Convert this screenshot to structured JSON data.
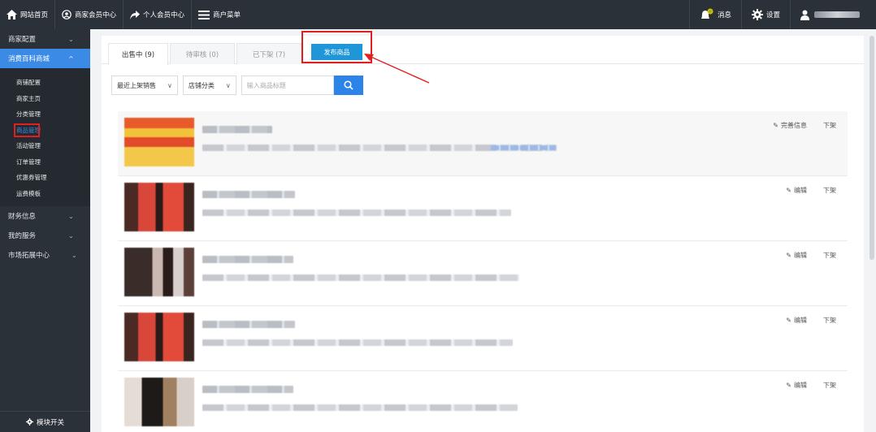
{
  "topbar": {
    "home": "网站首页",
    "merchant_center": "商家会员中心",
    "personal_center": "个人会员中心",
    "merchant_menu": "商户菜单",
    "messages": "消息",
    "settings": "设置"
  },
  "sidebar": {
    "merchant_config": "商家配置",
    "mall": "消费百科商城",
    "sub_items": [
      "商铺配置",
      "商家主页",
      "分类管理",
      "商品管理",
      "活动管理",
      "订单管理",
      "优惠券管理",
      "运费模板"
    ],
    "finance": "财务信息",
    "my_services": "我的服务",
    "market_center": "市场拓展中心",
    "module_switch": "模块开关"
  },
  "tabs": {
    "on_sale": "出售中 (9)",
    "pending": "待审核 (0)",
    "off_shelf": "已下架 (7)",
    "publish": "发布商品"
  },
  "filters": {
    "sort": "最近上架销售",
    "category": "店铺分类",
    "search_placeholder": "输入商品标题"
  },
  "products": [
    {
      "action1": "完善信息",
      "action2": "下架"
    },
    {
      "action1": "编辑",
      "action2": "下架"
    },
    {
      "action1": "编辑",
      "action2": "下架"
    },
    {
      "action1": "编辑",
      "action2": "下架"
    },
    {
      "action1": "编辑",
      "action2": "下架"
    }
  ],
  "colors": {
    "topbar_bg": "#2b3138",
    "accent": "#3b8be6",
    "publish_btn": "#1f96d8",
    "highlight": "#e02020"
  }
}
